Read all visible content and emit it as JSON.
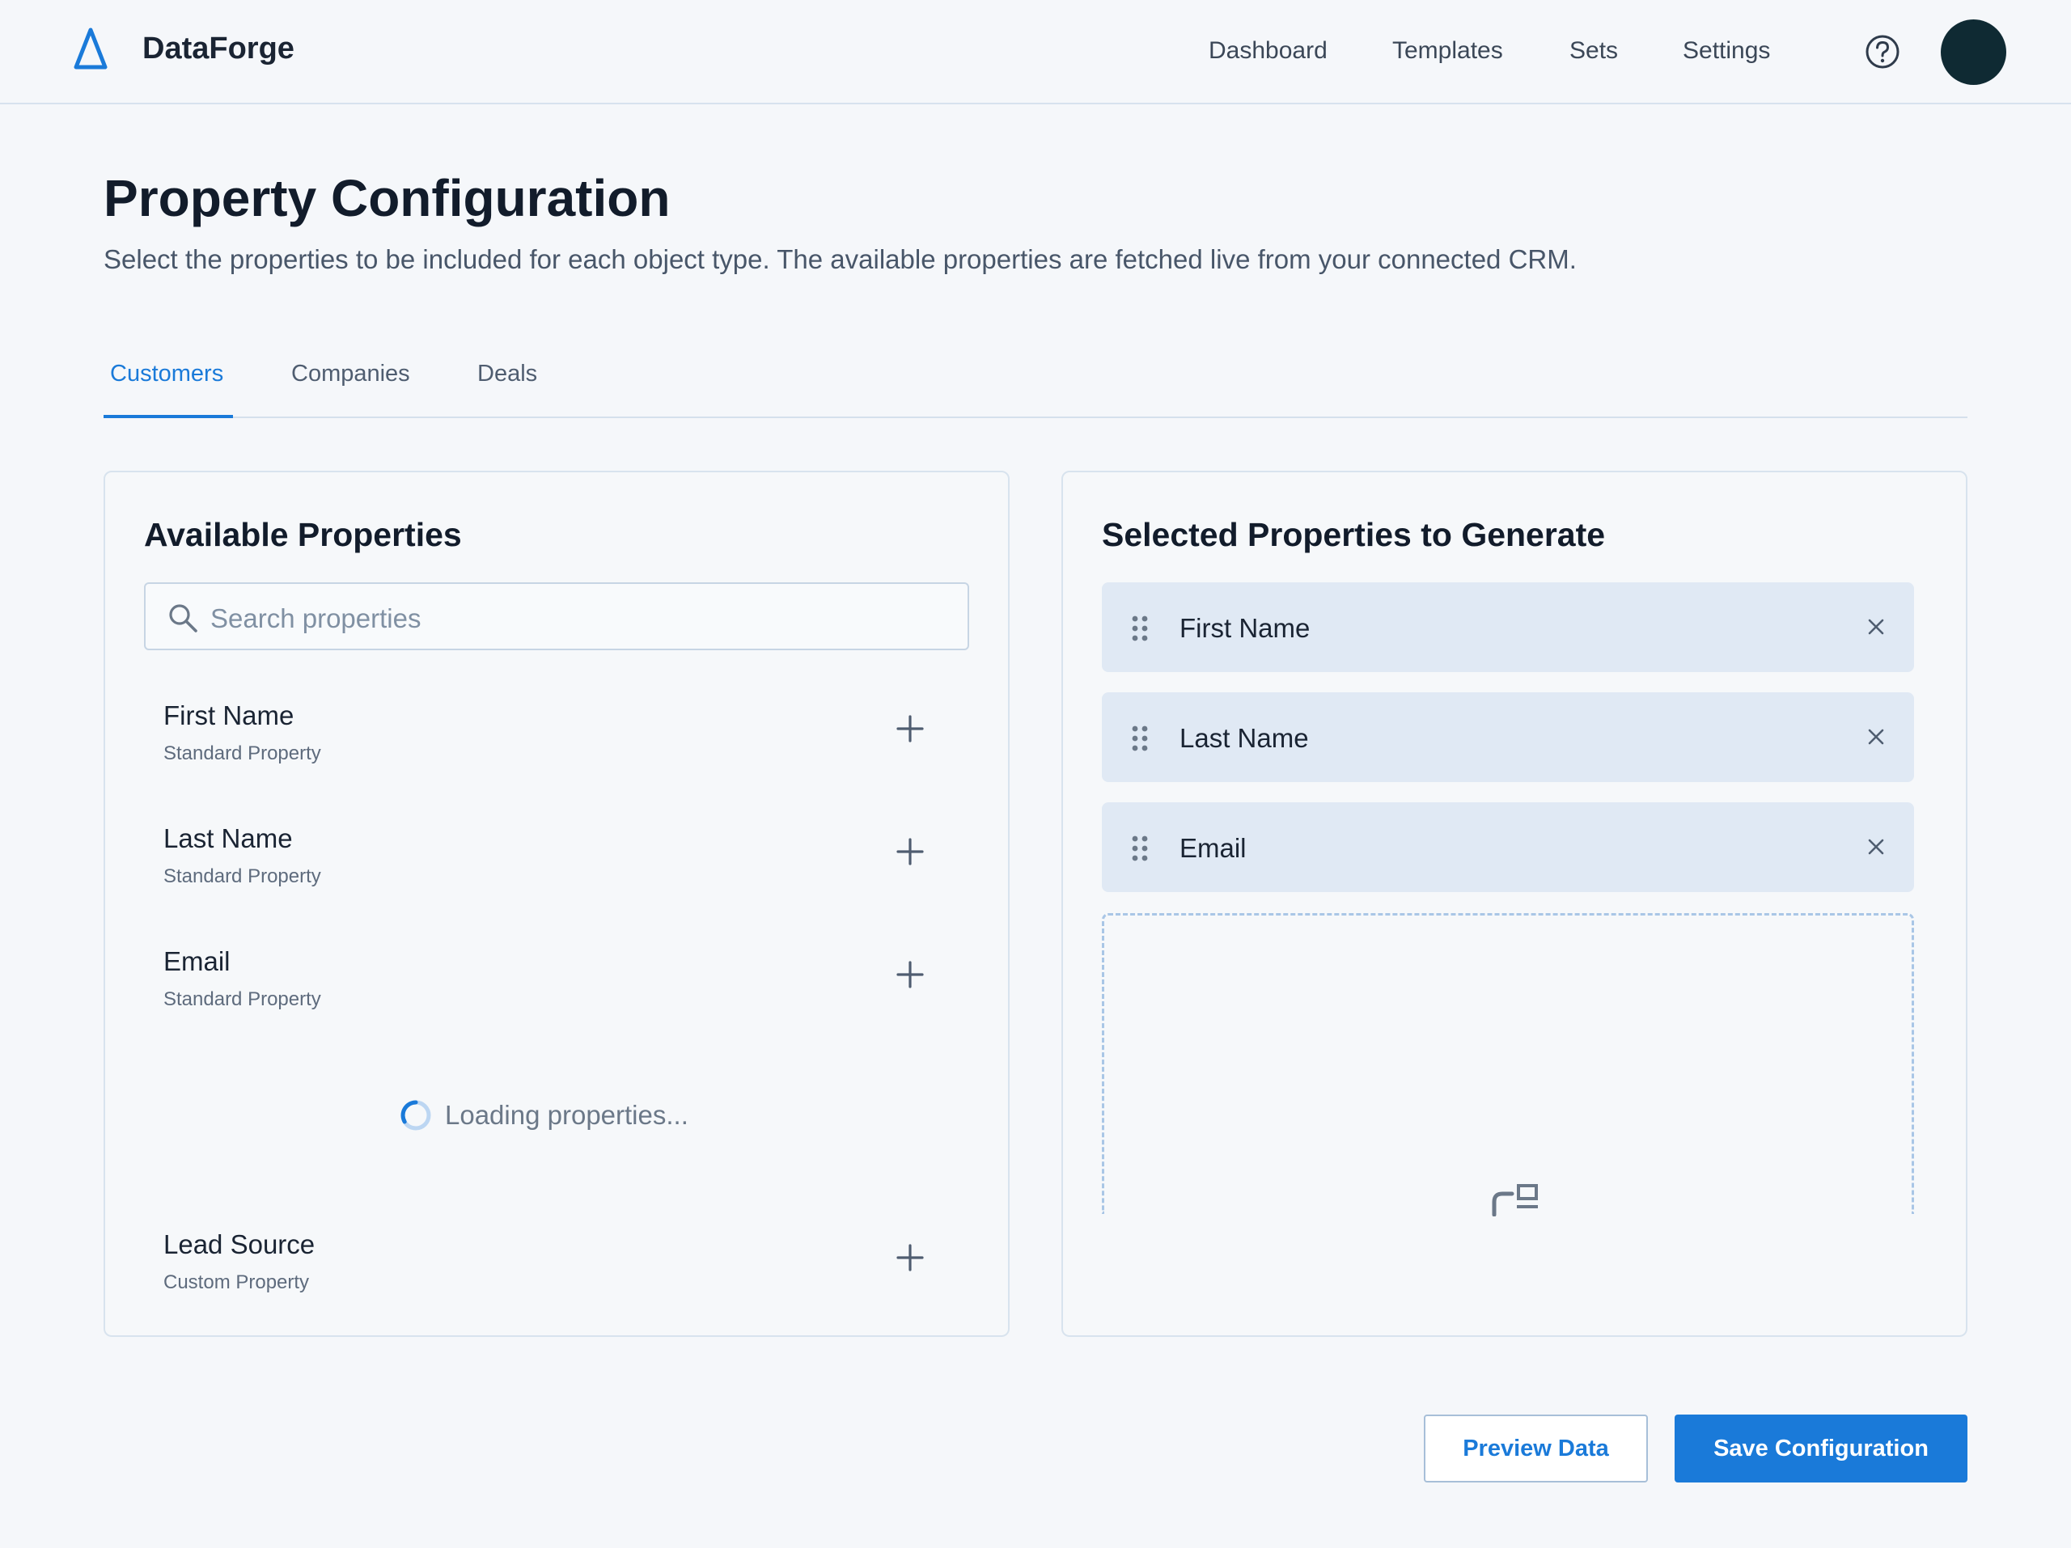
{
  "app": {
    "brand": "DataForge",
    "accent_color": "#1a7ad9"
  },
  "nav": {
    "items": [
      {
        "label": "Dashboard"
      },
      {
        "label": "Templates"
      },
      {
        "label": "Sets"
      },
      {
        "label": "Settings"
      }
    ],
    "help_icon": "help-circle-icon",
    "avatar_icon": "user-avatar"
  },
  "page": {
    "title": "Property Configuration",
    "subtitle": "Select the properties to be included for each object type. The available properties are fetched live from your connected CRM."
  },
  "tabs": [
    {
      "label": "Customers",
      "active": true
    },
    {
      "label": "Companies",
      "active": false
    },
    {
      "label": "Deals",
      "active": false
    }
  ],
  "available": {
    "title": "Available Properties",
    "search_placeholder": "Search properties",
    "items": [
      {
        "name": "First Name",
        "type": "Standard Property"
      },
      {
        "name": "Last Name",
        "type": "Standard Property"
      },
      {
        "name": "Email",
        "type": "Standard Property"
      },
      {
        "name": "Lead Source",
        "type": "Custom Property"
      }
    ],
    "loading_text": "Loading properties..."
  },
  "selected": {
    "title": "Selected Properties to Generate",
    "items": [
      {
        "label": "First Name"
      },
      {
        "label": "Last Name"
      },
      {
        "label": "Email"
      }
    ]
  },
  "actions": {
    "preview_label": "Preview Data",
    "save_label": "Save Configuration"
  }
}
